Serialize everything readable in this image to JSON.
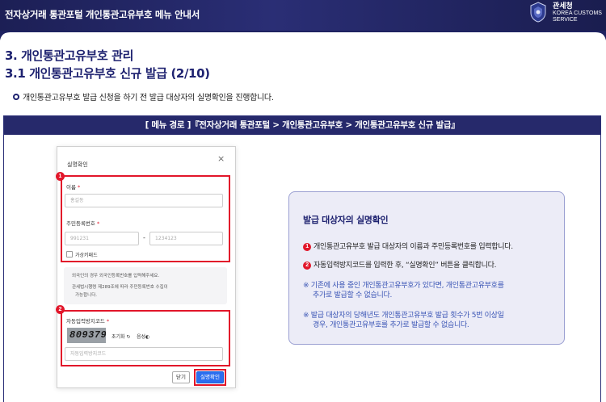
{
  "banner": {
    "title": "전자상거래 통관포털 개인통관고유부호 메뉴 안내서",
    "org_kr": "관세청",
    "org_en_1": "KOREA CUSTOMS",
    "org_en_2": "SERVICE"
  },
  "section": {
    "heading": "3. 개인통관고유부호 관리",
    "subheading": "3.1 개인통관고유부호 신규 발급 (2/10)",
    "intro": "개인통관고유부호 발급 신청을 하기 전 발급 대상자의 실명확인을 진행합니다."
  },
  "menu_path": "[ 메뉴 경로 ]『전자상거래 통관포털 > 개인통관고유부호 > 개인통관고유부호 신규 발급』",
  "dialog": {
    "title": "실명확인",
    "close_glyph": "×",
    "marker_1": "1",
    "marker_2": "2",
    "name_label": "이름",
    "required_mark": "*",
    "name_placeholder": "홍길동",
    "rrn_label": "주민등록번호",
    "rrn_front_placeholder": "991231",
    "rrn_dash": "-",
    "rrn_back_placeholder": "1234123",
    "virtual_keyboard": "가상키패드",
    "notice_1": "외국인의 경우 외국인등록번호를 입력해주세요.",
    "notice_2": "관세법시행령 제289조에 따라 주민등록번호 수집이",
    "notice_3": "가능합니다.",
    "captcha_label": "자동입력방지코드",
    "captcha_text": "809379",
    "reset_label": "초기화",
    "audio_label": "음성",
    "captcha_placeholder": "자동입력방지코드",
    "btn_close": "닫기",
    "btn_confirm": "실명확인"
  },
  "info": {
    "title": "발급 대상자의 실명확인",
    "n1": "1",
    "n2": "2",
    "step1": "개인통관고유부호 발급 대상자의 이름과 주민등록번호를 입력합니다.",
    "step2": "자동입력방지코드를 입력한 후, “실명확인” 버튼을 클릭합니다.",
    "note1_a": "※ 기존에 사용 중인 개인통관고유부호가 있다면, 개인통관고유부호를",
    "note1_b": "추가로 발급할 수 없습니다.",
    "note2_a": "※ 발급 대상자의 당해년도 개인통관고유부호 발급 횟수가 5번 이상일",
    "note2_b": "경우, 개인통관고유부호를 추가로 발급할 수 없습니다."
  },
  "colors": {
    "navy": "#1e2270",
    "highlight_red": "#e2162a",
    "note_blue": "#3a55b5",
    "confirm_blue": "#2b6ef0"
  }
}
